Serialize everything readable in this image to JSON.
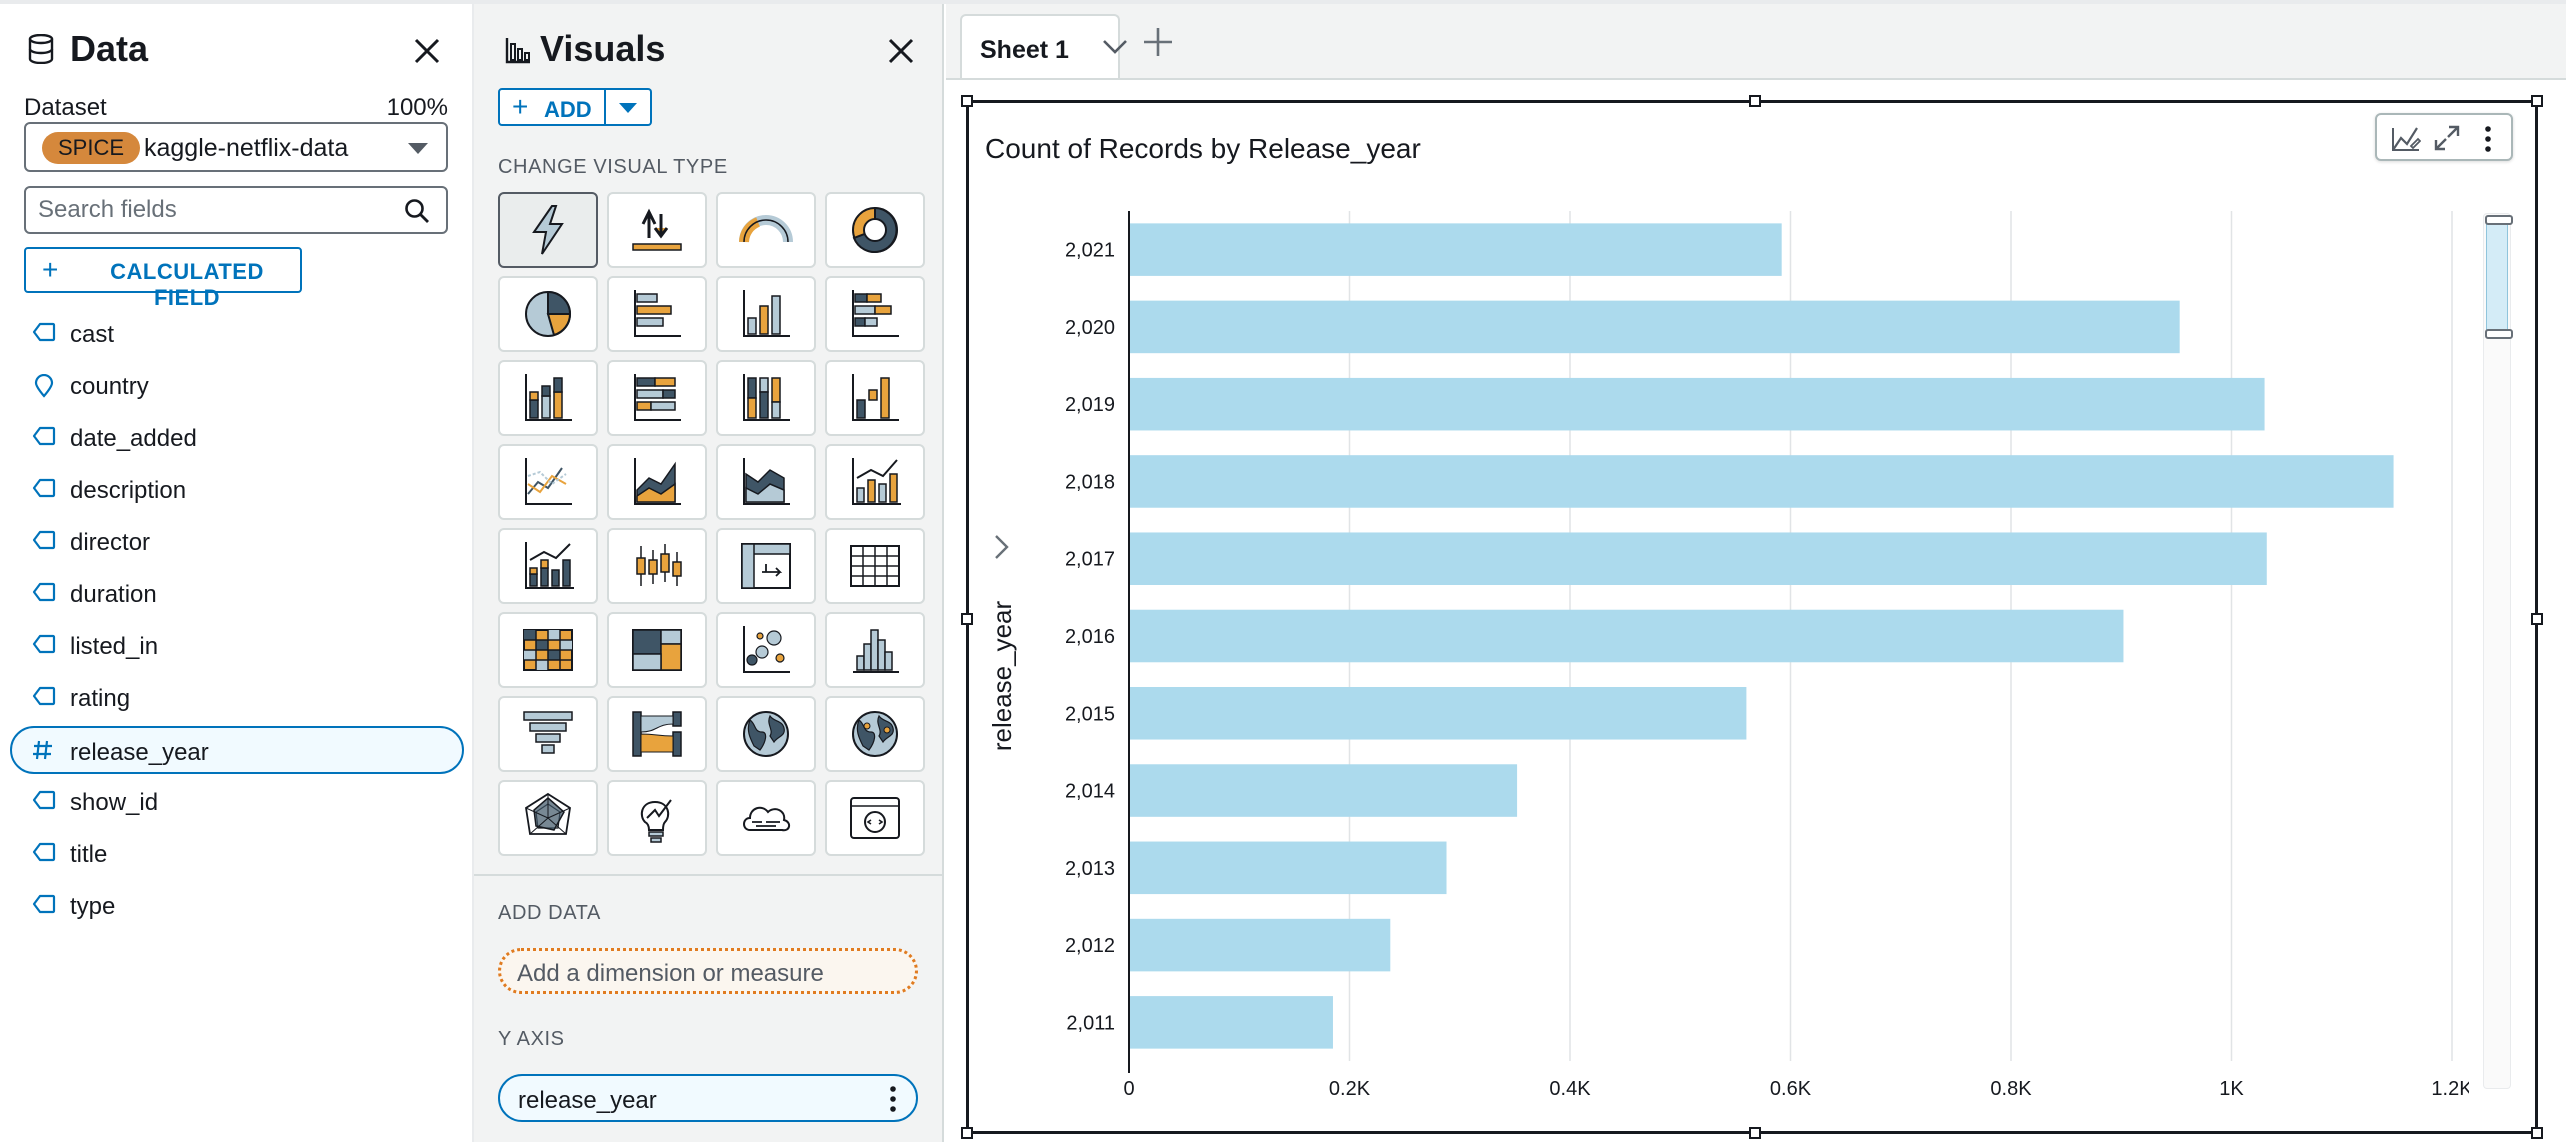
{
  "data_panel": {
    "title": "Data",
    "dataset_label": "Dataset",
    "dataset_percent": "100%",
    "spice_badge": "SPICE",
    "dataset_name": "kaggle-netflix-data",
    "search_placeholder": "Search fields",
    "calculated_field_label": "CALCULATED FIELD",
    "fields": [
      {
        "name": "cast",
        "icon": "dimension-tag-icon"
      },
      {
        "name": "country",
        "icon": "location-pin-icon"
      },
      {
        "name": "date_added",
        "icon": "dimension-tag-icon"
      },
      {
        "name": "description",
        "icon": "dimension-tag-icon"
      },
      {
        "name": "director",
        "icon": "dimension-tag-icon"
      },
      {
        "name": "duration",
        "icon": "dimension-tag-icon"
      },
      {
        "name": "listed_in",
        "icon": "dimension-tag-icon"
      },
      {
        "name": "rating",
        "icon": "dimension-tag-icon"
      },
      {
        "name": "release_year",
        "icon": "measure-hash-icon",
        "selected": true
      },
      {
        "name": "show_id",
        "icon": "dimension-tag-icon"
      },
      {
        "name": "title",
        "icon": "dimension-tag-icon"
      },
      {
        "name": "type",
        "icon": "dimension-tag-icon"
      }
    ]
  },
  "visuals_panel": {
    "title": "Visuals",
    "add_label": "ADD",
    "change_visual_type_label": "CHANGE VISUAL TYPE",
    "visual_types": [
      "autograph",
      "kpi",
      "gauge",
      "donut",
      "pie",
      "horizontal-bar",
      "vertical-bar",
      "horizontal-stacked-bar",
      "vertical-stacked-bar",
      "horizontal-stacked-100-bar",
      "vertical-stacked-100-bar",
      "waterfall",
      "line",
      "area",
      "stacked-area",
      "combo-bar-line",
      "combo-stacked-line",
      "box-plot",
      "pivot-table",
      "table",
      "heat-map",
      "tree-map",
      "scatter-plot",
      "histogram",
      "funnel",
      "sankey",
      "filled-map",
      "points-map",
      "radar",
      "insight",
      "word-cloud",
      "custom-visual"
    ],
    "active_visual_type": "autograph",
    "add_data_label": "ADD DATA",
    "add_dimension_placeholder": "Add a dimension or measure",
    "y_axis_label": "Y AXIS",
    "y_axis_field": "release_year"
  },
  "sheet": {
    "tab_label": "Sheet 1",
    "visual_title": "Count of Records by Release_year"
  },
  "colors": {
    "bar": "#acdaed",
    "accent": "#0073bb",
    "spice": "#d5883c"
  },
  "chart_data": {
    "type": "bar",
    "orientation": "horizontal",
    "title": "Count of Records by Release_year",
    "ylabel": "release_year",
    "xlabel": "",
    "categories": [
      "2,021",
      "2,020",
      "2,019",
      "2,018",
      "2,017",
      "2,016",
      "2,015",
      "2,014",
      "2,013",
      "2,012",
      "2,011"
    ],
    "values": [
      592,
      953,
      1030,
      1147,
      1032,
      902,
      560,
      352,
      288,
      237,
      185
    ],
    "x_ticks": [
      "0",
      "0.2K",
      "0.4K",
      "0.6K",
      "0.8K",
      "1K",
      "1.2K"
    ],
    "xlim": [
      0,
      1200
    ],
    "grid": true,
    "legend": "none"
  }
}
